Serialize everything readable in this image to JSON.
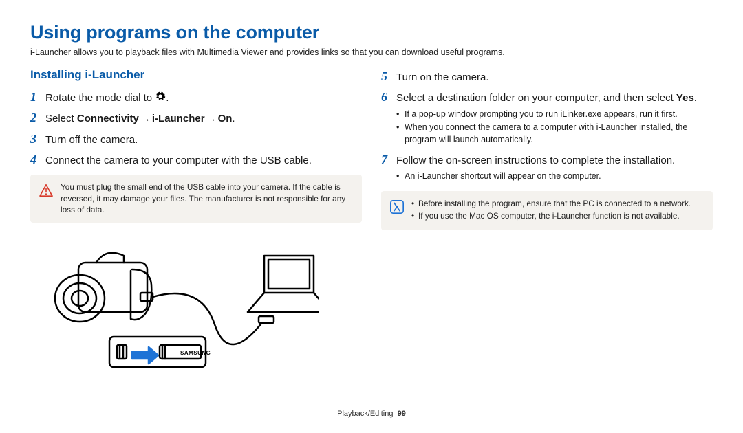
{
  "title": "Using programs on the computer",
  "intro": "i-Launcher allows you to playback files with Multimedia Viewer and provides links so that you can download useful programs.",
  "section_title": "Installing i-Launcher",
  "left": {
    "step1_a": "Rotate the mode dial to ",
    "step1_b": ".",
    "step2_a": "Select ",
    "step2_b": "Connectivity",
    "step2_c": "i-Launcher",
    "step2_d": "On",
    "step2_e": ".",
    "step3": "Turn off the camera.",
    "step4": "Connect the camera to your computer with the USB cable.",
    "warn": "You must plug the small end of the USB cable into your camera. If the cable is reversed, it may damage your files. The manufacturer is not responsible for any loss of data."
  },
  "right": {
    "step5": "Turn on the camera.",
    "step6_a": "Select a destination folder on your computer, and then select ",
    "step6_b": "Yes",
    "step6_c": ".",
    "sub6_a": "If a pop-up window prompting you to run iLinker.exe appears, run it first.",
    "sub6_b": "When you connect the camera to a computer with i-Launcher installed, the program will launch automatically.",
    "step7": "Follow the on-screen instructions to complete the installation.",
    "sub7_a": "An i-Launcher shortcut will appear on the computer.",
    "info_a": "Before installing the program, ensure that the PC is connected to a network.",
    "info_b": "If you use the Mac OS computer, the i-Launcher function is not available."
  },
  "footer_section": "Playback/Editing",
  "footer_page": "99",
  "nums": {
    "n1": "1",
    "n2": "2",
    "n3": "3",
    "n4": "4",
    "n5": "5",
    "n6": "6",
    "n7": "7"
  },
  "arrow": "→"
}
